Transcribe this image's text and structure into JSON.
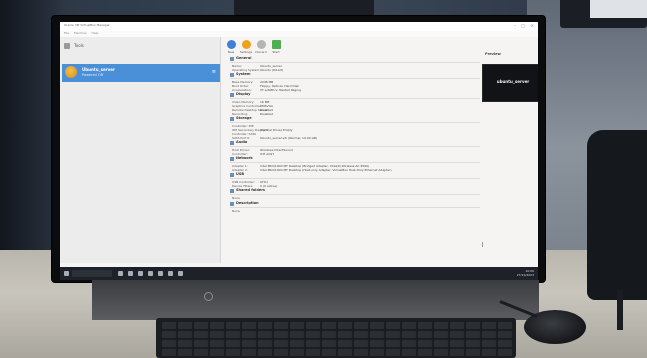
{
  "window": {
    "title": "Oracle VM VirtualBox Manager",
    "menu": [
      "File",
      "Machine",
      "Help"
    ],
    "controls": [
      "–",
      "□",
      "×"
    ]
  },
  "sidebar": {
    "tools_label": "Tools",
    "vm": {
      "name": "Ubuntu_server",
      "state": "Powered Off"
    }
  },
  "toolbar": {
    "buttons": [
      {
        "label": "New",
        "color": "#3f7fd6"
      },
      {
        "label": "Settings",
        "color": "#f0a11b"
      },
      {
        "label": "Discard",
        "color": "#b5b5b5"
      },
      {
        "label": "Start",
        "color": "#4caf50"
      }
    ]
  },
  "details": {
    "general": {
      "title": "General",
      "rows": [
        {
          "k": "Name:",
          "v": "Ubuntu_server"
        },
        {
          "k": "Operating System:",
          "v": "Ubuntu (64-bit)"
        }
      ]
    },
    "system": {
      "title": "System",
      "rows": [
        {
          "k": "Base Memory:",
          "v": "2048 MB"
        },
        {
          "k": "Boot Order:",
          "v": "Floppy, Optical, Hard Disk"
        },
        {
          "k": "Acceleration:",
          "v": "VT-x/AMD-V, Nested Paging"
        }
      ]
    },
    "display": {
      "title": "Display",
      "rows": [
        {
          "k": "Video Memory:",
          "v": "16 MB"
        },
        {
          "k": "Graphics Controller:",
          "v": "VMSVGA"
        },
        {
          "k": "Remote Desktop Server:",
          "v": "Disabled"
        },
        {
          "k": "Recording:",
          "v": "Disabled"
        }
      ]
    },
    "storage": {
      "title": "Storage",
      "rows": [
        {
          "k": "Controller: IDE",
          "v": ""
        },
        {
          "k": "IDE Secondary Device 0:",
          "v": "[Optical Drive] Empty"
        },
        {
          "k": "Controller: SATA",
          "v": ""
        },
        {
          "k": "SATA Port 0:",
          "v": "Ubuntu_server.vdi (Normal, 10.00 GB)"
        }
      ]
    },
    "audio": {
      "title": "Audio",
      "rows": [
        {
          "k": "Host Driver:",
          "v": "Windows DirectSound"
        },
        {
          "k": "Controller:",
          "v": "ICH AC97"
        }
      ]
    },
    "network": {
      "title": "Network",
      "rows": [
        {
          "k": "Adapter 1:",
          "v": "Intel PRO/1000 MT Desktop (Bridged Adapter, Intel(R) Wireless-AC 9560)"
        },
        {
          "k": "Adapter 2:",
          "v": "Intel PRO/1000 MT Desktop (Host-only Adapter, VirtualBox Host-Only Ethernet Adapter)"
        }
      ]
    },
    "usb": {
      "title": "USB",
      "rows": [
        {
          "k": "USB Controller:",
          "v": "OHCI"
        },
        {
          "k": "Device Filters:",
          "v": "0 (0 active)"
        }
      ]
    },
    "shared": {
      "title": "Shared folders",
      "rows": [
        {
          "k": "None",
          "v": ""
        }
      ]
    },
    "description": {
      "title": "Description",
      "rows": [
        {
          "k": "None",
          "v": ""
        }
      ]
    }
  },
  "preview": {
    "label": "Preview",
    "text": "ubuntu_server"
  },
  "taskbar": {
    "tray_time": "10:06",
    "tray_date": "27/10/2023"
  }
}
